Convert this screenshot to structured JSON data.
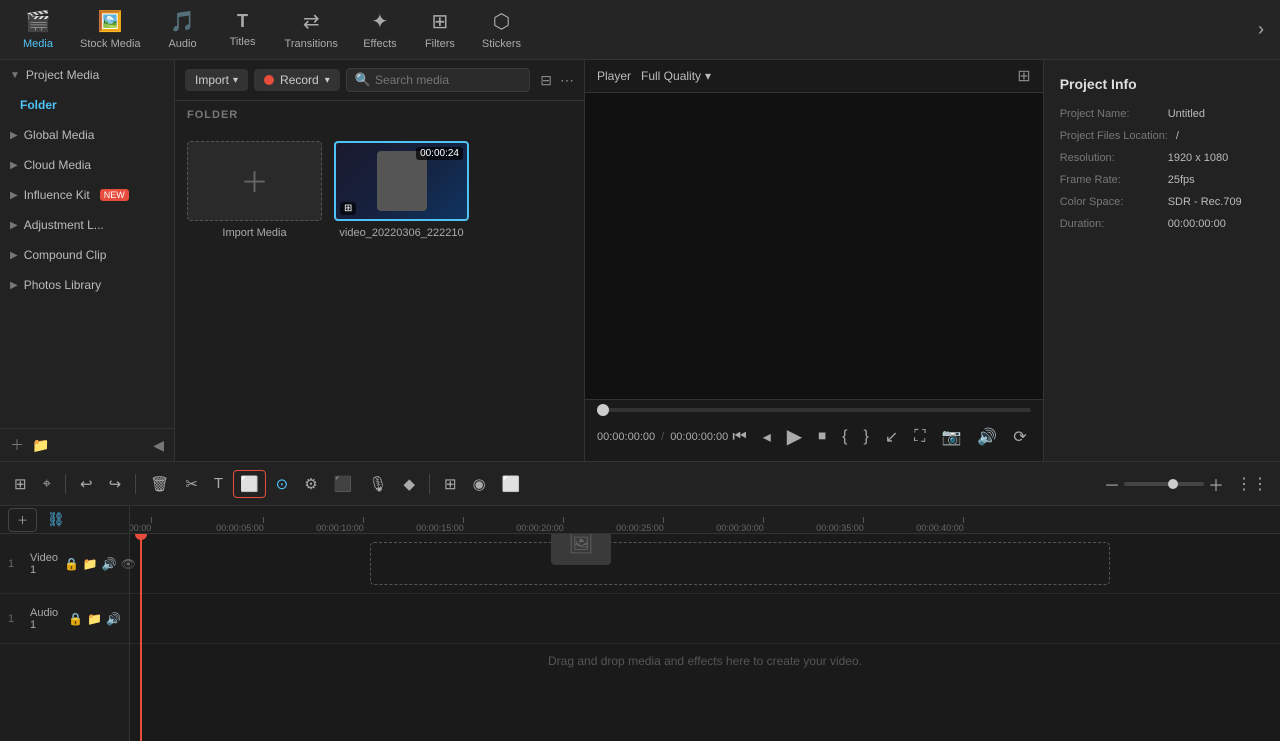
{
  "nav": {
    "items": [
      {
        "id": "media",
        "label": "Media",
        "icon": "🎬",
        "active": true
      },
      {
        "id": "stock",
        "label": "Stock Media",
        "icon": "🖼️",
        "active": false
      },
      {
        "id": "audio",
        "label": "Audio",
        "icon": "🎵",
        "active": false
      },
      {
        "id": "titles",
        "label": "Titles",
        "icon": "T",
        "active": false
      },
      {
        "id": "transitions",
        "label": "Transitions",
        "icon": "↕",
        "active": false
      },
      {
        "id": "effects",
        "label": "Effects",
        "icon": "✨",
        "active": false
      },
      {
        "id": "filters",
        "label": "Filters",
        "icon": "🔲",
        "active": false
      },
      {
        "id": "stickers",
        "label": "Stickers",
        "icon": "⬡",
        "active": false
      }
    ],
    "more_icon": "›"
  },
  "sidebar": {
    "items": [
      {
        "id": "project-media",
        "label": "Project Media",
        "active": true
      },
      {
        "id": "folder",
        "label": "Folder",
        "is_folder": true
      },
      {
        "id": "global-media",
        "label": "Global Media"
      },
      {
        "id": "cloud-media",
        "label": "Cloud Media"
      },
      {
        "id": "influence-kit",
        "label": "Influence Kit",
        "badge": "NEW"
      },
      {
        "id": "adjustment",
        "label": "Adjustment L..."
      },
      {
        "id": "compound-clip",
        "label": "Compound Clip"
      },
      {
        "id": "photos-library",
        "label": "Photos Library"
      }
    ],
    "bottom_icons": [
      "＋",
      "📁",
      "◀"
    ]
  },
  "media_panel": {
    "import_label": "Import",
    "record_label": "Record",
    "search_placeholder": "Search media",
    "folder_section": "FOLDER",
    "import_media_label": "Import Media",
    "video_name": "video_20220306_222210",
    "video_duration": "00:00:24"
  },
  "player": {
    "label": "Player",
    "quality": "Full Quality",
    "current_time": "00:00:00:00",
    "total_time": "00:00:00:00"
  },
  "project_info": {
    "title": "Project Info",
    "fields": [
      {
        "label": "Project Name:",
        "value": "Untitled"
      },
      {
        "label": "Project Files Location:",
        "value": "/"
      },
      {
        "label": "Resolution:",
        "value": "1920 x 1080"
      },
      {
        "label": "Frame Rate:",
        "value": "25fps"
      },
      {
        "label": "Color Space:",
        "value": "SDR - Rec.709"
      },
      {
        "label": "Duration:",
        "value": "00:00:00:00"
      }
    ]
  },
  "timeline": {
    "ruler_marks": [
      {
        "time": "00:00",
        "offset": 10
      },
      {
        "time": "00:00:05:00",
        "offset": 100
      },
      {
        "time": "00:00:10:00",
        "offset": 200
      },
      {
        "time": "00:00:15:00",
        "offset": 300
      },
      {
        "time": "00:00:20:00",
        "offset": 400
      },
      {
        "time": "00:00:25:00",
        "offset": 500
      },
      {
        "time": "00:00:30:00",
        "offset": 600
      },
      {
        "time": "00:00:35:00",
        "offset": 700
      },
      {
        "time": "00:00:40:00",
        "offset": 800
      }
    ],
    "tracks": [
      {
        "id": "video1",
        "num": "1",
        "name": "Video 1",
        "type": "video"
      },
      {
        "id": "audio1",
        "num": "1",
        "name": "Audio 1",
        "type": "audio"
      }
    ],
    "drop_text": "Drag and drop media and effects here to create your video."
  }
}
